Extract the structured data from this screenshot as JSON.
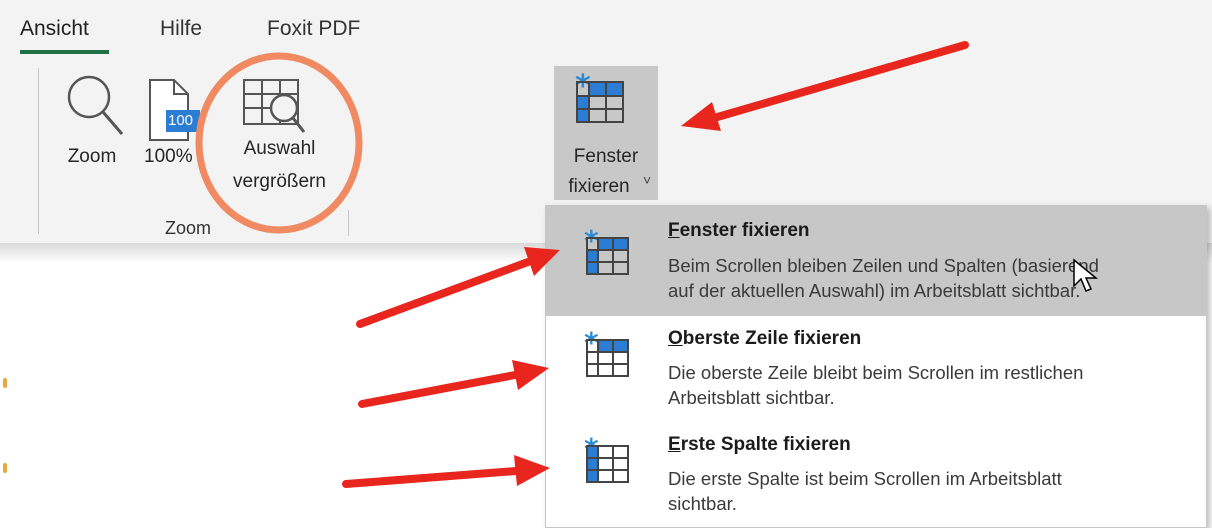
{
  "ribbon": {
    "tabs": [
      {
        "label": "Ansicht",
        "active": true
      },
      {
        "label": "Hilfe",
        "active": false
      },
      {
        "label": "Foxit PDF",
        "active": false
      }
    ],
    "accent_color": "#1e7145",
    "zoom_group": {
      "label": "Zoom",
      "buttons": {
        "zoom": {
          "label": "Zoom",
          "icon": "magnifier-icon"
        },
        "hundred": {
          "label": "100%",
          "icon": "page-100-icon",
          "badge": "100"
        },
        "auswahl": {
          "label_line1": "Auswahl",
          "label_line2": "vergrößern",
          "icon": "zoom-to-selection-icon"
        }
      }
    },
    "fenster_fixieren": {
      "label_line1": "Fenster",
      "label_line2": "fixieren",
      "dropdown_caret": "˅",
      "icon": "freeze-panes-icon"
    }
  },
  "freeze_menu": {
    "items": [
      {
        "title": "Fenster fixieren",
        "mnemonic": "F",
        "title_rest": "enster fixieren",
        "desc_line1": "Beim Scrollen bleiben Zeilen und Spalten (basierend",
        "desc_line2": "auf der aktuellen Auswahl) im Arbeitsblatt sichtbar.",
        "icon": "freeze-panes-icon",
        "highlighted": true
      },
      {
        "title": "Oberste Zeile fixieren",
        "mnemonic": "O",
        "title_rest": "berste Zeile fixieren",
        "desc_line1": "Die oberste Zeile bleibt beim Scrollen im restlichen",
        "desc_line2": "Arbeitsblatt sichtbar.",
        "icon": "freeze-top-row-icon",
        "highlighted": false
      },
      {
        "title": "Erste Spalte fixieren",
        "mnemonic": "E",
        "title_rest": "rste Spalte fixieren",
        "desc_line1": "Die erste Spalte ist beim Scrollen im Arbeitsblatt",
        "desc_line2": "sichtbar.",
        "icon": "freeze-first-column-icon",
        "highlighted": false
      }
    ]
  },
  "annotations": {
    "arrow_color": "#e8261e",
    "circle_color": "#f08a62"
  }
}
